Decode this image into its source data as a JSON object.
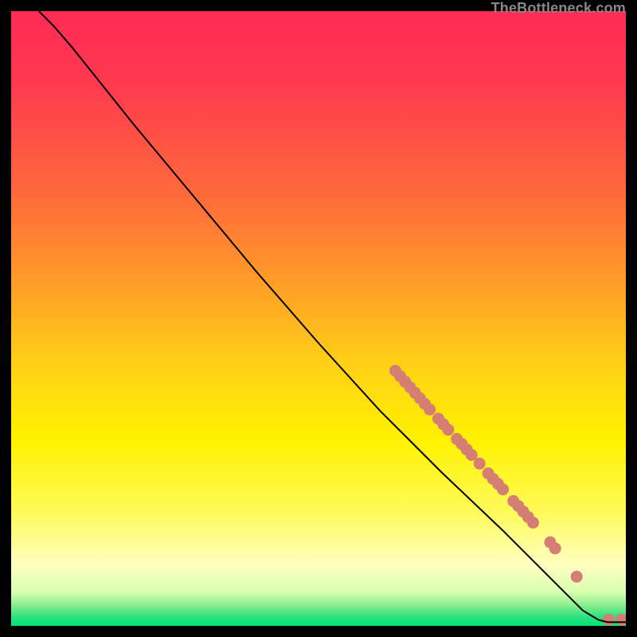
{
  "watermark": "TheBottleneck.com",
  "chart_data": {
    "type": "line",
    "title": "",
    "xlabel": "",
    "ylabel": "",
    "xlim": [
      0,
      100
    ],
    "ylim": [
      0,
      100
    ],
    "background_gradient_stops": [
      {
        "offset": 0.0,
        "color": "#ff2a55"
      },
      {
        "offset": 0.12,
        "color": "#ff3a4f"
      },
      {
        "offset": 0.3,
        "color": "#ff6a3b"
      },
      {
        "offset": 0.45,
        "color": "#ffa027"
      },
      {
        "offset": 0.58,
        "color": "#ffd215"
      },
      {
        "offset": 0.7,
        "color": "#fff200"
      },
      {
        "offset": 0.82,
        "color": "#fffb60"
      },
      {
        "offset": 0.9,
        "color": "#ffffc0"
      },
      {
        "offset": 0.945,
        "color": "#d8ffb0"
      },
      {
        "offset": 0.965,
        "color": "#90f090"
      },
      {
        "offset": 0.985,
        "color": "#30e080"
      },
      {
        "offset": 1.0,
        "color": "#00e676"
      }
    ],
    "series": [
      {
        "name": "bottleneck-curve",
        "color": "#000000",
        "points": [
          {
            "x": 4.5,
            "y": 100.0
          },
          {
            "x": 7.0,
            "y": 97.5
          },
          {
            "x": 10.0,
            "y": 94.0
          },
          {
            "x": 14.0,
            "y": 89.0
          },
          {
            "x": 20.0,
            "y": 81.5
          },
          {
            "x": 30.0,
            "y": 69.5
          },
          {
            "x": 40.0,
            "y": 57.5
          },
          {
            "x": 50.0,
            "y": 46.0
          },
          {
            "x": 60.0,
            "y": 35.0
          },
          {
            "x": 70.0,
            "y": 25.0
          },
          {
            "x": 80.0,
            "y": 15.5
          },
          {
            "x": 86.0,
            "y": 9.5
          },
          {
            "x": 90.0,
            "y": 5.5
          },
          {
            "x": 93.0,
            "y": 2.5
          },
          {
            "x": 95.5,
            "y": 1.0
          },
          {
            "x": 97.0,
            "y": 0.6
          },
          {
            "x": 100.0,
            "y": 0.6
          }
        ]
      }
    ],
    "marker_clusters": {
      "color": "#d57e74",
      "radius": 7.5,
      "points": [
        {
          "x": 62.5,
          "y": 41.5
        },
        {
          "x": 63.3,
          "y": 40.6
        },
        {
          "x": 64.1,
          "y": 39.7
        },
        {
          "x": 64.9,
          "y": 38.8
        },
        {
          "x": 65.7,
          "y": 37.9
        },
        {
          "x": 66.5,
          "y": 37.0
        },
        {
          "x": 67.3,
          "y": 36.1
        },
        {
          "x": 68.1,
          "y": 35.2
        },
        {
          "x": 69.5,
          "y": 33.7
        },
        {
          "x": 70.3,
          "y": 32.8
        },
        {
          "x": 71.1,
          "y": 31.9
        },
        {
          "x": 72.5,
          "y": 30.4
        },
        {
          "x": 73.3,
          "y": 29.6
        },
        {
          "x": 74.1,
          "y": 28.7
        },
        {
          "x": 74.9,
          "y": 27.8
        },
        {
          "x": 76.2,
          "y": 26.4
        },
        {
          "x": 77.6,
          "y": 24.8
        },
        {
          "x": 78.4,
          "y": 23.9
        },
        {
          "x": 79.2,
          "y": 23.1
        },
        {
          "x": 80.0,
          "y": 22.2
        },
        {
          "x": 81.7,
          "y": 20.3
        },
        {
          "x": 82.5,
          "y": 19.5
        },
        {
          "x": 83.3,
          "y": 18.6
        },
        {
          "x": 84.1,
          "y": 17.7
        },
        {
          "x": 84.9,
          "y": 16.8
        },
        {
          "x": 87.7,
          "y": 13.6
        },
        {
          "x": 88.5,
          "y": 12.6
        },
        {
          "x": 92.0,
          "y": 8.0
        },
        {
          "x": 97.2,
          "y": 1.0
        },
        {
          "x": 99.3,
          "y": 1.0
        }
      ]
    }
  }
}
